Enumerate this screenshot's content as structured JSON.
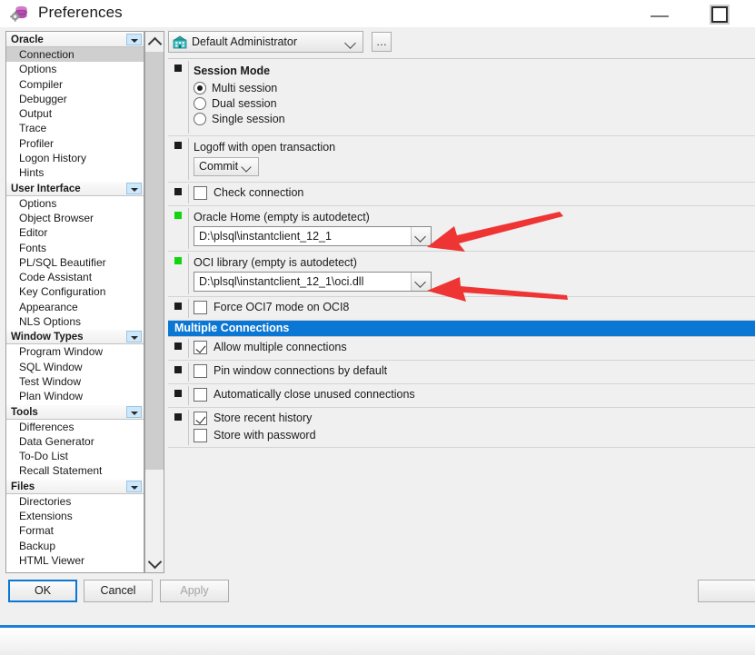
{
  "window": {
    "title": "Preferences",
    "icon": "database-gear-icon",
    "controls": {
      "minimize": "minimize-icon",
      "maximize": "maximize-icon"
    }
  },
  "sidebar": {
    "scroll": {
      "up": "chevron-up-icon",
      "down": "chevron-down-icon"
    },
    "groups": [
      {
        "label": "Oracle",
        "expander": "chevron-down-icon",
        "items": [
          {
            "label": "Connection",
            "selected": true
          },
          {
            "label": "Options",
            "selected": false
          },
          {
            "label": "Compiler",
            "selected": false
          },
          {
            "label": "Debugger",
            "selected": false
          },
          {
            "label": "Output",
            "selected": false
          },
          {
            "label": "Trace",
            "selected": false
          },
          {
            "label": "Profiler",
            "selected": false
          },
          {
            "label": "Logon History",
            "selected": false
          },
          {
            "label": "Hints",
            "selected": false
          }
        ]
      },
      {
        "label": "User Interface",
        "expander": "chevron-down-icon",
        "items": [
          {
            "label": "Options",
            "selected": false
          },
          {
            "label": "Object Browser",
            "selected": false
          },
          {
            "label": "Editor",
            "selected": false
          },
          {
            "label": "Fonts",
            "selected": false
          },
          {
            "label": "PL/SQL Beautifier",
            "selected": false
          },
          {
            "label": "Code Assistant",
            "selected": false
          },
          {
            "label": "Key Configuration",
            "selected": false
          },
          {
            "label": "Appearance",
            "selected": false
          },
          {
            "label": "NLS Options",
            "selected": false
          }
        ]
      },
      {
        "label": "Window Types",
        "expander": "chevron-down-icon",
        "items": [
          {
            "label": "Program Window",
            "selected": false
          },
          {
            "label": "SQL Window",
            "selected": false
          },
          {
            "label": "Test Window",
            "selected": false
          },
          {
            "label": "Plan Window",
            "selected": false
          }
        ]
      },
      {
        "label": "Tools",
        "expander": "chevron-down-icon",
        "items": [
          {
            "label": "Differences",
            "selected": false
          },
          {
            "label": "Data Generator",
            "selected": false
          },
          {
            "label": "To-Do List",
            "selected": false
          },
          {
            "label": "Recall Statement",
            "selected": false
          }
        ]
      },
      {
        "label": "Files",
        "expander": "chevron-down-icon",
        "items": [
          {
            "label": "Directories",
            "selected": false
          },
          {
            "label": "Extensions",
            "selected": false
          },
          {
            "label": "Format",
            "selected": false
          },
          {
            "label": "Backup",
            "selected": false
          },
          {
            "label": "HTML Viewer",
            "selected": false
          }
        ]
      }
    ]
  },
  "profile": {
    "icon": "administrator-icon",
    "value": "Default Administrator",
    "chevron": "chevron-down-icon",
    "more_button": "…"
  },
  "settings": {
    "session_mode": {
      "marker": "default",
      "title": "Session Mode",
      "options": [
        {
          "label": "Multi session",
          "selected": true
        },
        {
          "label": "Dual session",
          "selected": false
        },
        {
          "label": "Single session",
          "selected": false
        }
      ]
    },
    "logoff": {
      "marker": "default",
      "label": "Logoff with open transaction",
      "value": "Commit"
    },
    "check_connection": {
      "marker": "default",
      "label": "Check connection",
      "checked": false
    },
    "oracle_home": {
      "marker": "changed",
      "label": "Oracle Home (empty is autodetect)",
      "value": "D:\\plsql\\instantclient_12_1"
    },
    "oci_library": {
      "marker": "changed",
      "label": "OCI library (empty is autodetect)",
      "value": "D:\\plsql\\instantclient_12_1\\oci.dll"
    },
    "force_oci7": {
      "marker": "default",
      "label": "Force OCI7 mode on OCI8",
      "checked": false
    },
    "multiple_connections_header": "Multiple Connections",
    "allow_multiple": {
      "marker": "default",
      "label": "Allow multiple connections",
      "checked": true
    },
    "pin_window": {
      "marker": "default",
      "label": "Pin window connections by default",
      "checked": false
    },
    "auto_close": {
      "marker": "default",
      "label": "Automatically close unused connections",
      "checked": false
    },
    "store_history": {
      "marker": "default",
      "label": "Store recent history",
      "checked": true
    },
    "store_password": {
      "label": "Store with password",
      "checked": false
    }
  },
  "buttons": {
    "ok": "OK",
    "cancel": "Cancel",
    "apply": "Apply",
    "help": ""
  },
  "annotations": {
    "arrow_color": "#ef3434",
    "arrow_1_target": "oracle-home-combo",
    "arrow_2_target": "oci-library-combo"
  }
}
